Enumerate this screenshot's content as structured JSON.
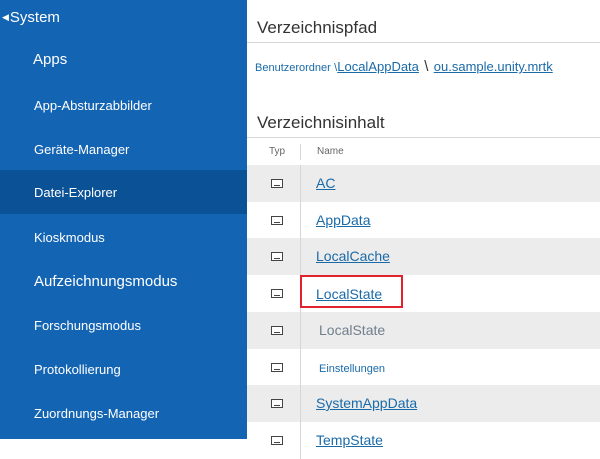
{
  "sidebar": {
    "system_label": "System",
    "apps_label": "Apps",
    "items": [
      {
        "label": "App-Absturzabbilder",
        "active": false
      },
      {
        "label": "Geräte-Manager",
        "active": false
      },
      {
        "label": "Datei-Explorer",
        "active": true
      },
      {
        "label": "Kioskmodus",
        "active": false
      },
      {
        "label": "Aufzeichnungsmodus",
        "active": false
      },
      {
        "label": "Forschungsmodus",
        "active": false
      },
      {
        "label": "Protokollierung",
        "active": false
      },
      {
        "label": "Zuordnungs-Manager",
        "active": false
      }
    ]
  },
  "path_section": {
    "title": "Verzeichnispfad",
    "root": "Benutzerordner",
    "segments": [
      "LocalAppData",
      "ou.sample.unity.mrtk"
    ],
    "separator": "\\"
  },
  "content_section": {
    "title": "Verzeichnisinhalt",
    "columns": [
      "Typ",
      "Name"
    ],
    "rows": [
      {
        "name": "AC",
        "style": "link"
      },
      {
        "name": "AppData",
        "style": "link"
      },
      {
        "name": "LocalCache",
        "style": "link"
      },
      {
        "name": "LocalState",
        "style": "link",
        "highlighted": true
      },
      {
        "name": "LocalState",
        "style": "plain"
      },
      {
        "name": "Einstellungen",
        "style": "small"
      },
      {
        "name": "SystemAppData",
        "style": "link"
      },
      {
        "name": "TempState",
        "style": "link"
      }
    ]
  },
  "colors": {
    "sidebar_bg": "#1464b4",
    "sidebar_active": "#0b5196",
    "link": "#1a6aa8",
    "highlight": "#e0232d"
  }
}
